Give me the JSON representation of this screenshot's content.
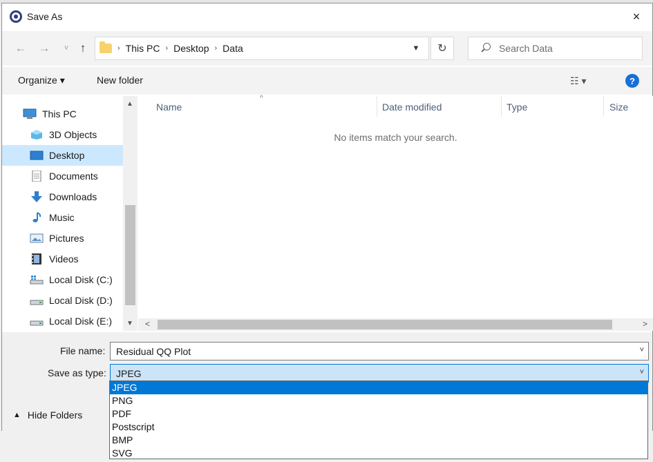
{
  "window": {
    "title": "Save As",
    "close_label": "×"
  },
  "nav": {
    "back": "←",
    "forward": "→",
    "recent": "˅",
    "up": "↑",
    "breadcrumbs": [
      "This PC",
      "Desktop",
      "Data"
    ],
    "refresh": "↻",
    "search_placeholder": "Search Data"
  },
  "toolbar": {
    "organize": "Organize ▾",
    "new_folder": "New folder",
    "view": "☷ ▾",
    "help": "?"
  },
  "sidebar": {
    "items": [
      {
        "label": "This PC",
        "icon": "computer-icon"
      },
      {
        "label": "3D Objects",
        "icon": "cube-icon"
      },
      {
        "label": "Desktop",
        "icon": "desktop-icon",
        "selected": true
      },
      {
        "label": "Documents",
        "icon": "document-icon"
      },
      {
        "label": "Downloads",
        "icon": "download-icon"
      },
      {
        "label": "Music",
        "icon": "music-icon"
      },
      {
        "label": "Pictures",
        "icon": "picture-icon"
      },
      {
        "label": "Videos",
        "icon": "video-icon"
      },
      {
        "label": "Local Disk (C:)",
        "icon": "drive-icon"
      },
      {
        "label": "Local Disk (D:)",
        "icon": "drive-icon"
      },
      {
        "label": "Local Disk (E:)",
        "icon": "drive-icon"
      }
    ]
  },
  "files": {
    "columns": [
      "Name",
      "Date modified",
      "Type",
      "Size"
    ],
    "empty_message": "No items match your search."
  },
  "form": {
    "file_name_label": "File name:",
    "file_name_value": "Residual QQ Plot",
    "save_type_label": "Save as type:",
    "save_type_value": "JPEG",
    "hide_folders": "Hide Folders"
  },
  "type_options": [
    "JPEG",
    "PNG",
    "PDF",
    "Postscript",
    "BMP",
    "SVG"
  ],
  "colors": {
    "selection": "#cce8ff",
    "accent": "#0078d7"
  }
}
